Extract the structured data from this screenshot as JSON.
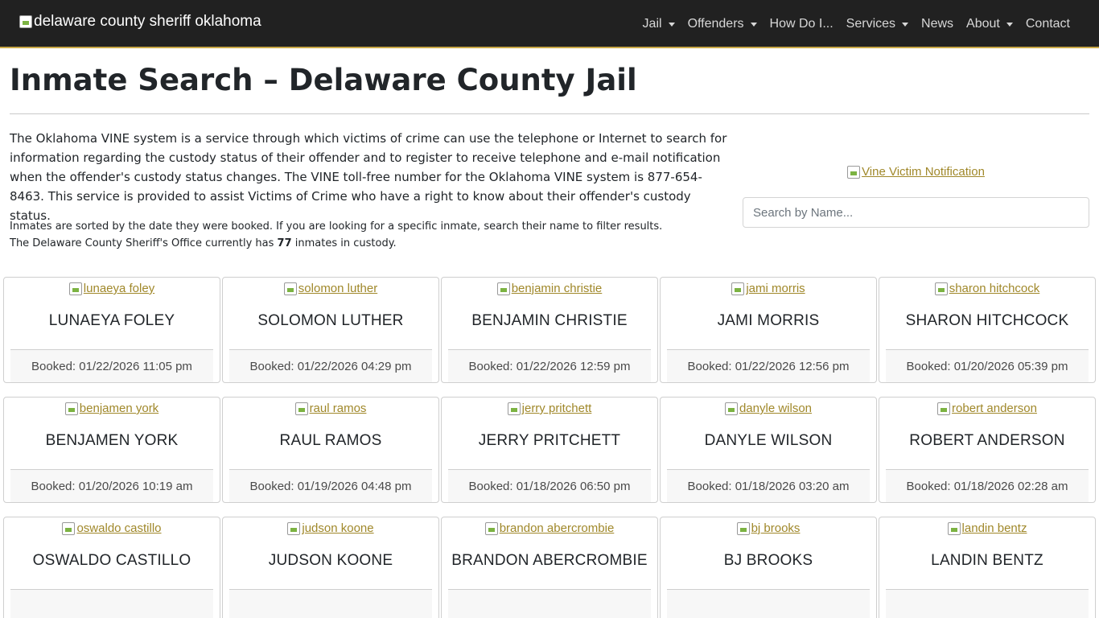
{
  "brand": {
    "alt_text": "delaware county sheriff oklahoma"
  },
  "nav": [
    {
      "label": "Jail",
      "dropdown": true
    },
    {
      "label": "Offenders",
      "dropdown": true
    },
    {
      "label": "How Do I...",
      "dropdown": false
    },
    {
      "label": "Services",
      "dropdown": true
    },
    {
      "label": "News",
      "dropdown": false
    },
    {
      "label": "About",
      "dropdown": true
    },
    {
      "label": "Contact",
      "dropdown": false
    }
  ],
  "page": {
    "title": "Inmate Search – Delaware County Jail",
    "intro": "The Oklahoma VINE system is a service through which victims of crime can use the telephone or Internet to search for information regarding the custody status of their offender and to register to receive telephone and e-mail notification when the offender's custody status changes. The VINE toll-free number for the Oklahoma VINE system is 877-654-8463. This service is provided to assist Victims of Crime who have a right to know about their offender's custody status.",
    "sort_note": "Inmates are sorted by the date they were booked. If you are looking for a specific inmate, search their name to filter results.",
    "count_prefix": "The Delaware County Sheriff's Office currently has",
    "count": "77",
    "count_suffix": "inmates in custody.",
    "vine_alt": "Vine Victim Notification",
    "search_placeholder": "Search by Name..."
  },
  "inmates": [
    {
      "img_alt": "lunaeya foley",
      "name": "LUNAEYA FOLEY",
      "booked": "Booked: 01/22/2026 11:05 pm"
    },
    {
      "img_alt": "solomon luther",
      "name": "SOLOMON LUTHER",
      "booked": "Booked: 01/22/2026 04:29 pm"
    },
    {
      "img_alt": "benjamin christie",
      "name": "BENJAMIN CHRISTIE",
      "booked": "Booked: 01/22/2026 12:59 pm"
    },
    {
      "img_alt": "jami morris",
      "name": "JAMI MORRIS",
      "booked": "Booked: 01/22/2026 12:56 pm"
    },
    {
      "img_alt": "sharon hitchcock",
      "name": "SHARON HITCHCOCK",
      "booked": "Booked: 01/20/2026 05:39 pm"
    },
    {
      "img_alt": "benjamen york",
      "name": "BENJAMEN YORK",
      "booked": "Booked: 01/20/2026 10:19 am"
    },
    {
      "img_alt": "raul ramos",
      "name": "RAUL RAMOS",
      "booked": "Booked: 01/19/2026 04:48 pm"
    },
    {
      "img_alt": "jerry pritchett",
      "name": "JERRY PRITCHETT",
      "booked": "Booked: 01/18/2026 06:50 pm"
    },
    {
      "img_alt": "danyle wilson",
      "name": "DANYLE WILSON",
      "booked": "Booked: 01/18/2026 03:20 am"
    },
    {
      "img_alt": "robert anderson",
      "name": "ROBERT ANDERSON",
      "booked": "Booked: 01/18/2026 02:28 am"
    },
    {
      "img_alt": "oswaldo castillo",
      "name": "OSWALDO CASTILLO",
      "booked": ""
    },
    {
      "img_alt": "judson koone",
      "name": "JUDSON KOONE",
      "booked": ""
    },
    {
      "img_alt": "brandon abercrombie",
      "name": "BRANDON ABERCROMBIE",
      "booked": ""
    },
    {
      "img_alt": "bj brooks",
      "name": "BJ BROOKS",
      "booked": ""
    },
    {
      "img_alt": "landin bentz",
      "name": "LANDIN BENTZ",
      "booked": ""
    }
  ]
}
